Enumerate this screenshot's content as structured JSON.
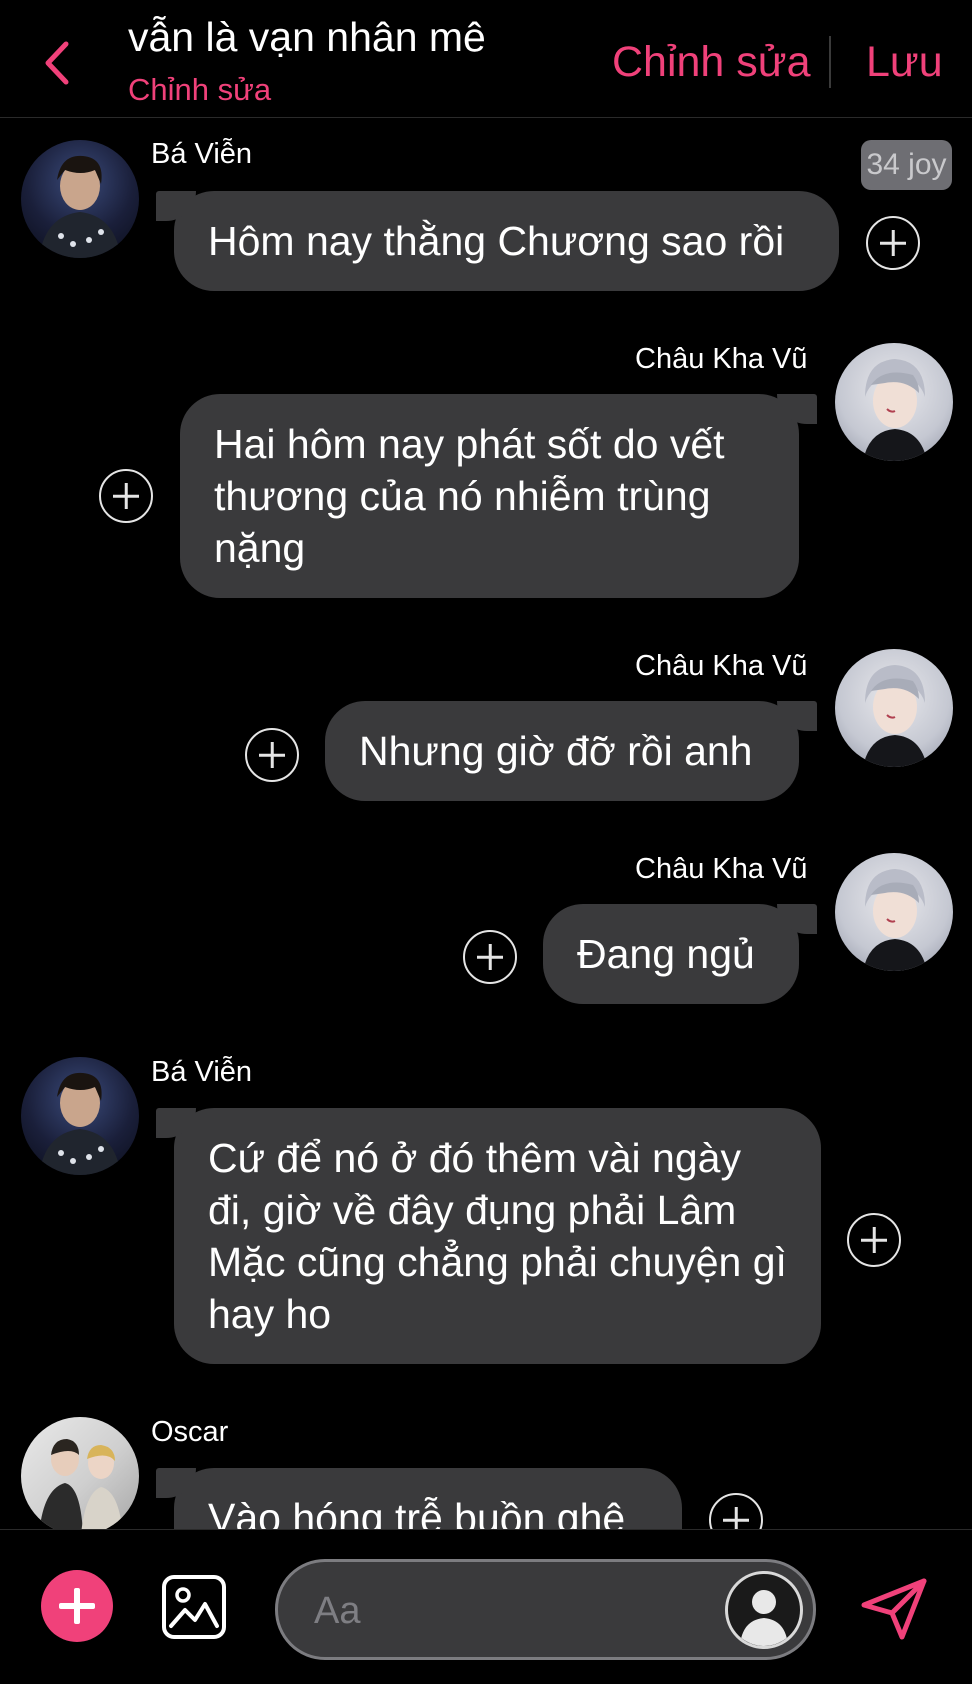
{
  "header": {
    "title": "vẫn là vạn nhân mê",
    "subtitle": "Chỉnh sửa",
    "edit_label": "Chỉnh sửa",
    "save_label": "Lưu"
  },
  "badge": "34 joy",
  "messages": [
    {
      "sender": "Bá Viễn",
      "side": "left",
      "text": "Hôm nay thằng Chương sao rồi"
    },
    {
      "sender": "Châu Kha Vũ",
      "side": "right",
      "text": "Hai hôm nay phát sốt do vết thương của nó nhiễm trùng nặng"
    },
    {
      "sender": "Châu Kha Vũ",
      "side": "right",
      "text": "Nhưng giờ đỡ rồi anh"
    },
    {
      "sender": "Châu Kha Vũ",
      "side": "right",
      "text": "Đang ngủ"
    },
    {
      "sender": "Bá Viễn",
      "side": "left",
      "text": "Cứ để nó ở đó thêm vài ngày đi, giờ về đây đụng phải Lâm Mặc cũng chẳng phải chuyện gì hay ho"
    },
    {
      "sender": "Oscar",
      "side": "left",
      "text": "Vào hóng trễ buồn ghê"
    }
  ],
  "composer": {
    "placeholder": "Aa"
  },
  "icons": {
    "back": "chevron-left-icon",
    "add": "plus-icon",
    "image": "image-icon",
    "send": "send-icon",
    "add_reaction": "plus-circle-icon"
  },
  "colors": {
    "accent": "#f0417a",
    "background": "#000000",
    "bubble": "#3a3a3c",
    "badge": "#6e6e73"
  }
}
